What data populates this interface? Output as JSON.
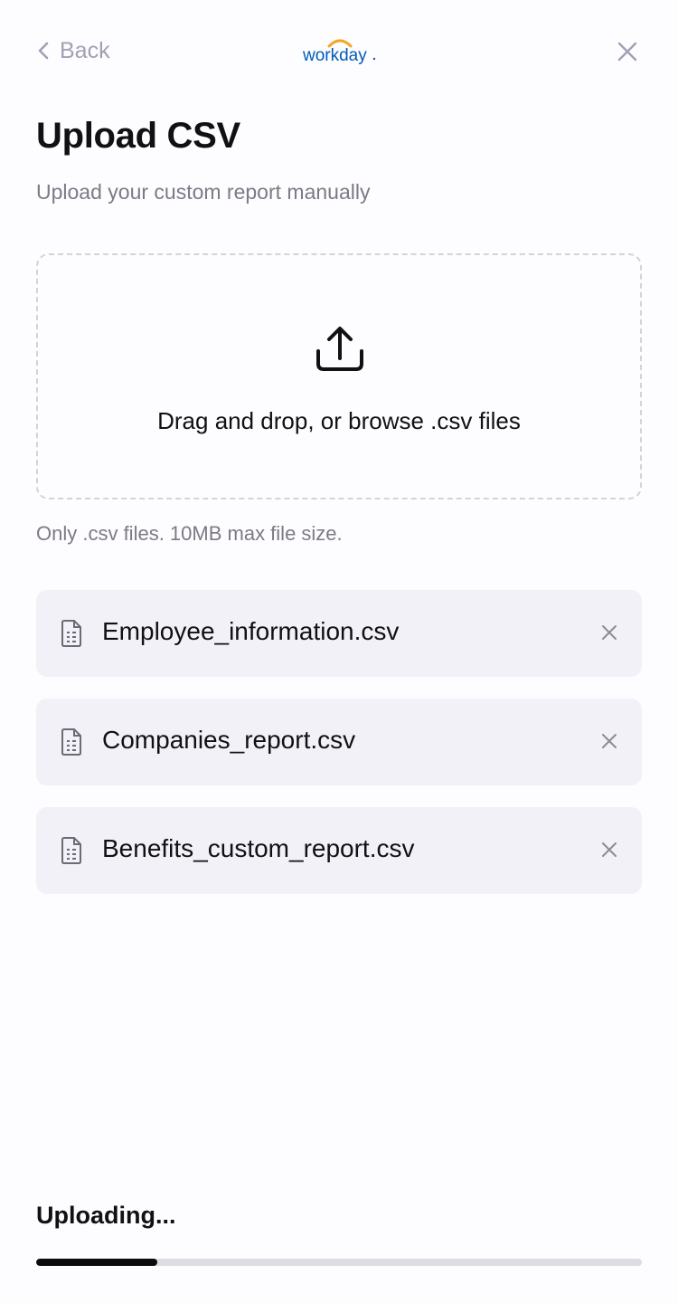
{
  "header": {
    "back_label": "Back",
    "logo_text": "workday",
    "back_icon": "chevron-left-icon",
    "close_icon": "close-icon"
  },
  "page": {
    "title": "Upload CSV",
    "subtitle": "Upload your custom report manually"
  },
  "dropzone": {
    "icon": "upload-icon",
    "text": "Drag and drop, or browse .csv files",
    "hint": "Only .csv files. 10MB max file size."
  },
  "files": [
    {
      "name": "Employee_information.csv",
      "icon": "file-icon",
      "remove_icon": "close-icon"
    },
    {
      "name": "Companies_report.csv",
      "icon": "file-icon",
      "remove_icon": "close-icon"
    },
    {
      "name": "Benefits_custom_report.csv",
      "icon": "file-icon",
      "remove_icon": "close-icon"
    }
  ],
  "upload": {
    "status_text": "Uploading...",
    "progress": 0.2
  },
  "colors": {
    "logo_blue": "#005cb9",
    "logo_orange": "#f5a623",
    "progress_fill": "#0b0b0e",
    "progress_track": "#dcdce3",
    "muted_text": "#7b7b86",
    "file_bg": "#f2f1f7"
  }
}
